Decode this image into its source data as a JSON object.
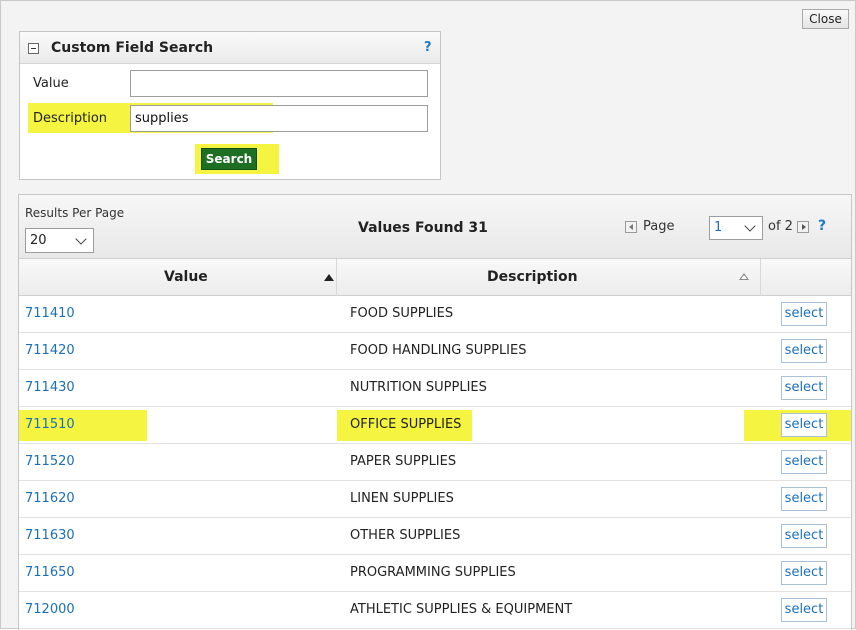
{
  "dialog": {
    "close_label": "Close"
  },
  "search": {
    "title": "Custom Field Search",
    "help": "?",
    "value_label": "Value",
    "value_input": "",
    "description_label": "Description",
    "description_input": "supplies",
    "search_label": "Search"
  },
  "results": {
    "rpp_label": "Results Per Page",
    "rpp_value": "20",
    "values_found": "Values Found 31",
    "page_label": "Page",
    "page_value": "1",
    "of_label": "of 2",
    "help": "?",
    "columns": {
      "value": "Value",
      "description": "Description"
    },
    "select_label": "select",
    "rows": [
      {
        "value": "711410",
        "description": "FOOD SUPPLIES"
      },
      {
        "value": "711420",
        "description": "FOOD HANDLING SUPPLIES"
      },
      {
        "value": "711430",
        "description": "NUTRITION SUPPLIES"
      },
      {
        "value": "711510",
        "description": "OFFICE SUPPLIES"
      },
      {
        "value": "711520",
        "description": "PAPER SUPPLIES"
      },
      {
        "value": "711620",
        "description": "LINEN SUPPLIES"
      },
      {
        "value": "711630",
        "description": "OTHER SUPPLIES"
      },
      {
        "value": "711650",
        "description": "PROGRAMMING SUPPLIES"
      },
      {
        "value": "712000",
        "description": "ATHLETIC SUPPLIES & EQUIPMENT"
      }
    ]
  },
  "colors": {
    "highlight": "#f5f541",
    "link": "#1c6fb8",
    "search_button": "#1e6f23"
  }
}
